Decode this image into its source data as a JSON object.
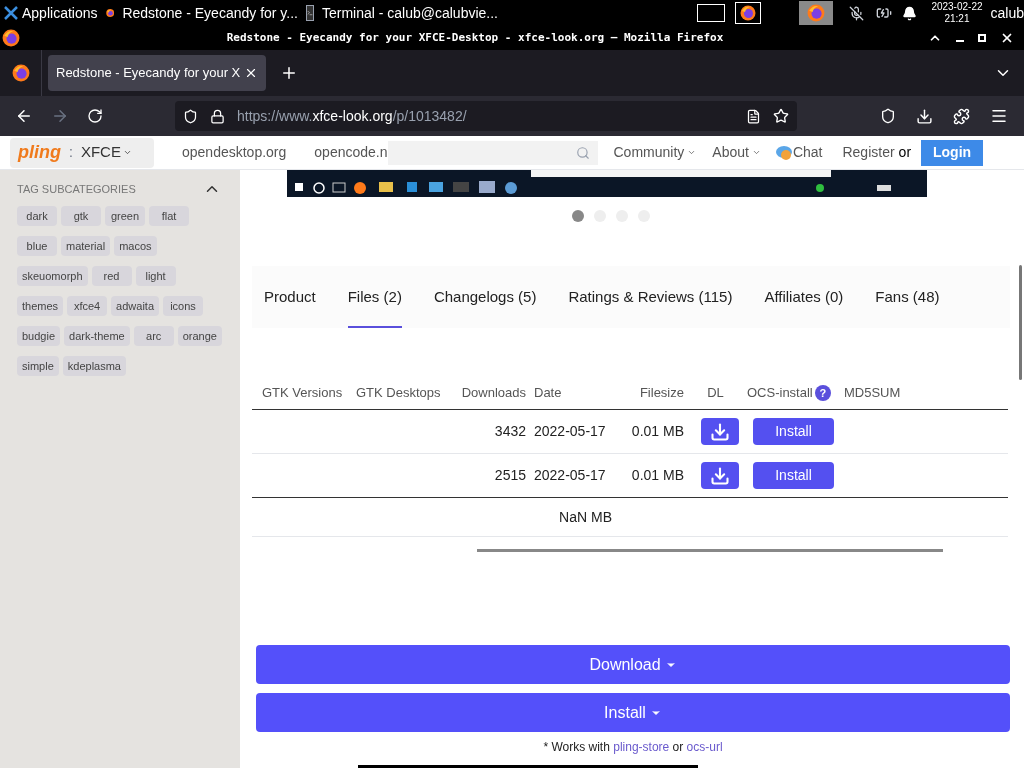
{
  "panel": {
    "apps_label": "Applications",
    "tasks": [
      {
        "title": "Redstone - Eyecandy for y...",
        "kind": "browser"
      },
      {
        "title": "Terminal - calub@calubvie...",
        "kind": "terminal"
      }
    ],
    "date": "2023-02-22",
    "time": "21:21",
    "user": "calub"
  },
  "window": {
    "title": "Redstone - Eyecandy for your XFCE-Desktop - xfce-look.org — Mozilla Firefox"
  },
  "browser": {
    "tab_title": "Redstone - Eyecandy for your X",
    "url_prefix": "https://www.",
    "url_domain": "xfce-look.org",
    "url_path": "/p/1013482/"
  },
  "site_header": {
    "logo": "pling",
    "separator": ":",
    "category": "XFCE",
    "links": [
      "opendesktop.org",
      "opencode.n"
    ],
    "nav": [
      "Community",
      "About"
    ],
    "chat": "Chat",
    "register": "Register",
    "or": "or",
    "login": "Login"
  },
  "sidebar": {
    "title": "TAG SUBCATEGORIES",
    "tag_rows": [
      [
        "dark",
        "gtk",
        "green",
        "flat"
      ],
      [
        "blue",
        "material",
        "macos"
      ],
      [
        "skeuomorph",
        "red",
        "light"
      ],
      [
        "themes",
        "xfce4",
        "adwaita",
        "icons"
      ],
      [
        "budgie",
        "dark-theme",
        "arc",
        "orange"
      ],
      [
        "simple",
        "kdeplasma"
      ]
    ]
  },
  "gallery": {
    "dots": [
      {
        "selected": true
      },
      {
        "selected": false
      },
      {
        "selected": false
      },
      {
        "selected": false
      }
    ]
  },
  "tabs": [
    {
      "label": "Product",
      "selected": false
    },
    {
      "label": "Files (2)",
      "selected": true
    },
    {
      "label": "Changelogs (5)",
      "selected": false
    },
    {
      "label": "Ratings & Reviews (115)",
      "selected": false
    },
    {
      "label": "Affiliates (0)",
      "selected": false
    },
    {
      "label": "Fans (48)",
      "selected": false
    }
  ],
  "files_table": {
    "columns": [
      "GTK Versions",
      "GTK Desktops",
      "Downloads",
      "Date",
      "Filesize",
      "DL",
      "OCS-install",
      "MD5SUM"
    ],
    "help": "?",
    "rows": [
      {
        "downloads": "3432",
        "date": "2022-05-17",
        "filesize": "0.01 MB",
        "install": "Install"
      },
      {
        "downloads": "2515",
        "date": "2022-05-17",
        "filesize": "0.01 MB",
        "install": "Install"
      }
    ],
    "total_filesize": "NaN MB"
  },
  "actions": {
    "download": "Download",
    "install": "Install",
    "note_prefix": "* Works with",
    "link_1": "pling-store",
    "note_or": "or",
    "link_2": "ocs-url"
  }
}
